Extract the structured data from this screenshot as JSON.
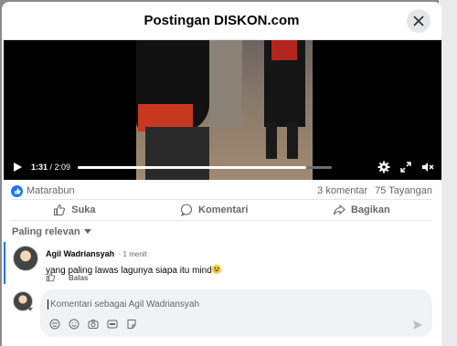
{
  "modal": {
    "title": "Postingan DISKON.com",
    "close_icon": "close-icon"
  },
  "video": {
    "current_time": "1:31",
    "separator": " / ",
    "duration": "2:09",
    "progress_fraction": 0.9,
    "icons": [
      "play-icon",
      "settings-icon",
      "fullscreen-icon",
      "mute-icon"
    ]
  },
  "stats": {
    "reaction_name": "Matarabun",
    "comments": "3 komentar",
    "views": "75 Tayangan"
  },
  "actions": {
    "like": "Suka",
    "comment": "Komentari",
    "share": "Bagikan"
  },
  "sort": {
    "label": "Paling relevan"
  },
  "comments": [
    {
      "author": "Agil Wadriansyah",
      "time": "1 menit",
      "text": "yang paling lawas lagunya siapa itu mind",
      "reply_label": "Balas"
    }
  ],
  "composer": {
    "placeholder": "Komentari sebagai Agil Wadriansyah",
    "tools": [
      "avatar-sticker-icon",
      "emoji-icon",
      "camera-icon",
      "gif-icon",
      "sticker-icon"
    ],
    "send_icon": "send-icon"
  },
  "colors": {
    "accent": "#1877f2",
    "text": "#050505",
    "muted": "#65676b"
  }
}
